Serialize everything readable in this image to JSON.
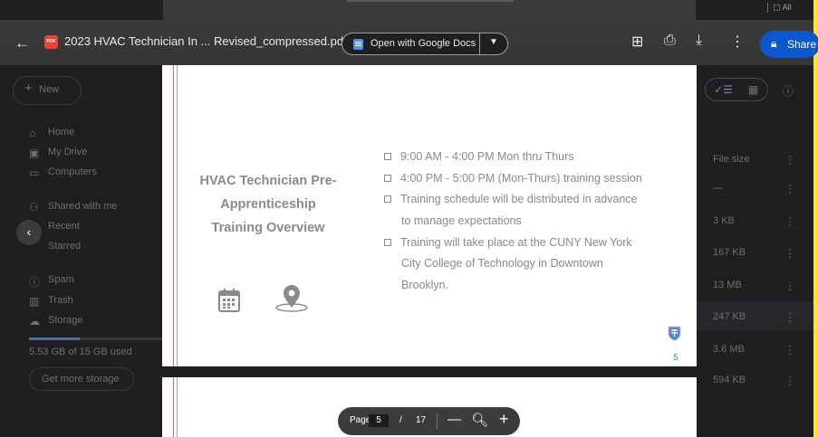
{
  "drive": {
    "new_label": "New",
    "nav": [
      "Home",
      "My Drive",
      "Computers",
      "Shared with me",
      "Recent",
      "Starred",
      "Spam",
      "Trash",
      "Storage"
    ],
    "storage_used": "5.53 GB of 15 GB used",
    "get_storage": "Get more storage",
    "file_size_header": "File size",
    "file_sizes": [
      "—",
      "3 KB",
      "167 KB",
      "13 MB",
      "247 KB",
      "3.6 MB",
      "594 KB"
    ],
    "top_right_label": "All"
  },
  "viewer": {
    "file_name": "2023 HVAC Technician In ... Revised_compressed.pdf",
    "pdf_badge": "PDF",
    "open_with": "Open with Google Docs",
    "share_label": "Share"
  },
  "pdf_page": {
    "title_lines": [
      "HVAC Technician Pre-",
      "Apprenticeship",
      "Training Overview"
    ],
    "bullets": [
      {
        "lines": [
          "9:00 AM - 4:00 PM Mon thru Thurs"
        ]
      },
      {
        "lines": [
          "4:00 PM - 5:00 PM (Mon-Thurs) training session"
        ]
      },
      {
        "lines": [
          "Training schedule will be distributed in advance",
          "to manage expectations"
        ]
      },
      {
        "lines": [
          "Training will take place at the CUNY New York",
          "City College of Technology in Downtown",
          "Brooklyn."
        ]
      }
    ],
    "page_number": "5"
  },
  "zoom_bar": {
    "page_label": "Page",
    "current_page": "5",
    "separator": "/",
    "total_pages": "17"
  },
  "colors": {
    "share_blue": "#0b57d0",
    "pdf_red": "#ea4335",
    "page_text": "#8a8a8a",
    "side_yellow": "#ffe81a"
  }
}
